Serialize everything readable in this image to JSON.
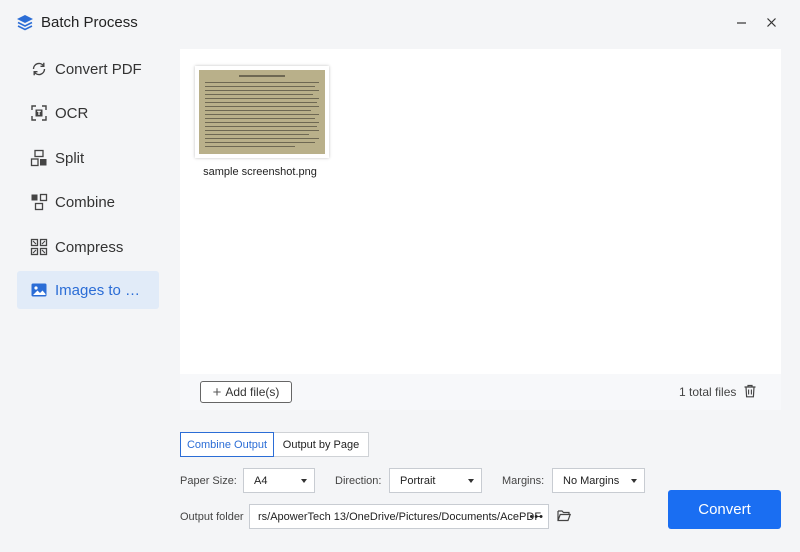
{
  "window": {
    "title": "Batch Process",
    "minimize_icon": "minimize-icon",
    "close_icon": "close-icon"
  },
  "sidebar": {
    "active_color": "#2b6dd6",
    "items": [
      {
        "label": "Convert PDF",
        "icon": "convert-icon"
      },
      {
        "label": "OCR",
        "icon": "ocr-icon"
      },
      {
        "label": "Split",
        "icon": "split-icon"
      },
      {
        "label": "Combine",
        "icon": "combine-icon"
      },
      {
        "label": "Compress",
        "icon": "compress-icon"
      },
      {
        "label": "Images to …",
        "icon": "image-icon",
        "active": true
      }
    ]
  },
  "files": {
    "items": [
      {
        "name": "sample screenshot.png"
      }
    ],
    "add_label": "Add file(s)",
    "total_label": "1 total files"
  },
  "output_tabs": {
    "combine": "Combine Output",
    "by_page": "Output by Page",
    "selected": "Combine Output"
  },
  "options": {
    "paper_size_label": "Paper Size:",
    "paper_size_value": "A4",
    "direction_label": "Direction:",
    "direction_value": "Portrait",
    "margins_label": "Margins:",
    "margins_value": "No Margins"
  },
  "output": {
    "folder_label": "Output folder",
    "folder_path": "rs/ApowerTech 13/OneDrive/Pictures/Documents/AcePDF",
    "more_label": "•••"
  },
  "convert_label": "Convert",
  "accent_color": "#1a6ef2"
}
